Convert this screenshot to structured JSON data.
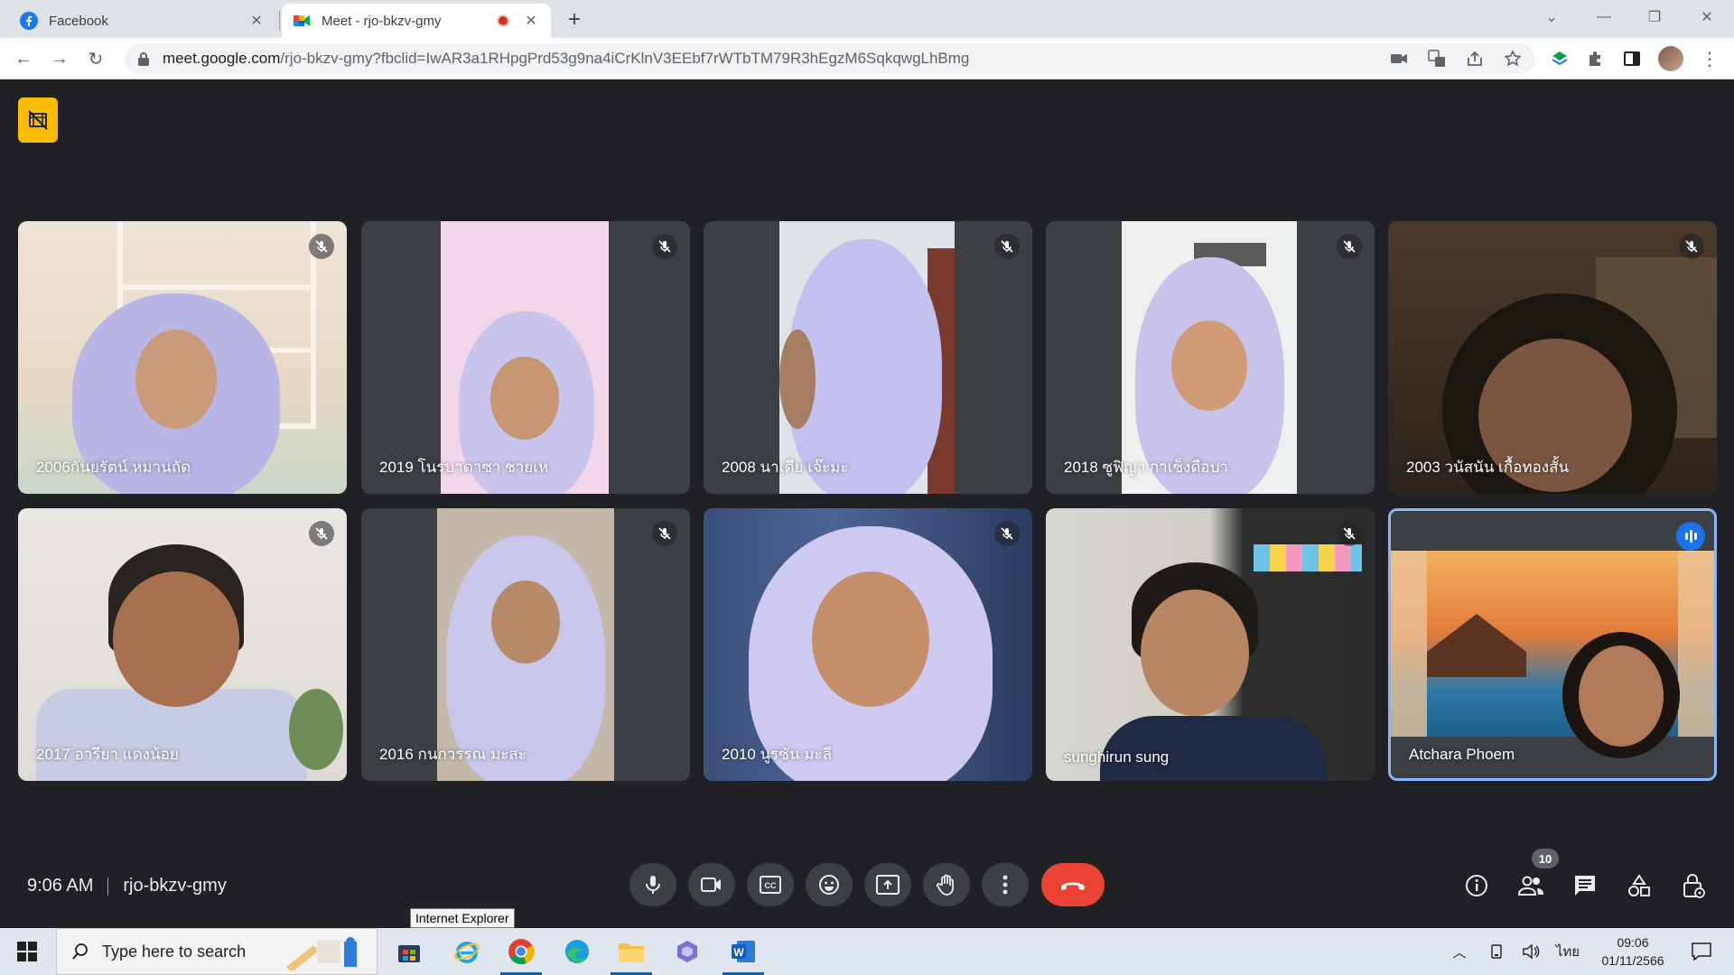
{
  "browser": {
    "tabs": [
      {
        "title": "Facebook",
        "active": false
      },
      {
        "title": "Meet - rjo-bkzv-gmy",
        "active": true,
        "recording": true
      }
    ],
    "url_host": "meet.google.com",
    "url_path": "/rjo-bkzv-gmy?fbclid=IwAR3a1RHpgPrd53g9na4iCrKlnV3EEbf7rWTbTM79R3hEgzM6SqkqwgLhBmg"
  },
  "meet": {
    "participants": [
      {
        "name": "2006กันยรัตน์ หมานถัด",
        "muted": true
      },
      {
        "name": "2019 โนรบาดาซา ชายเห",
        "muted": true
      },
      {
        "name": "2008 นาเดีย เจ๊ะมะ",
        "muted": true
      },
      {
        "name": "2018 ซูฟิญา กาเซ็งดือบา",
        "muted": true
      },
      {
        "name": "2003 วนัสนัน เกื้อทองสั้น",
        "muted": true
      },
      {
        "name": "2017 อารียา แดงน้อย",
        "muted": true
      },
      {
        "name": "2016 กนกวรรณ มะสะ",
        "muted": true
      },
      {
        "name": "2010 นูรซัน มะลี",
        "muted": true
      },
      {
        "name": "sunghirun sung",
        "muted": true
      },
      {
        "name": "Atchara Phoem",
        "muted": false,
        "speaking": true
      }
    ],
    "time": "9:06 AM",
    "meeting_code": "rjo-bkzv-gmy",
    "participant_count": "10",
    "colors": {
      "end_call": "#ea4335",
      "speaking": "#1a73e8",
      "active_border": "#8ab4f8",
      "badge": "#fbbc04"
    }
  },
  "tooltip": "Internet Explorer",
  "taskbar": {
    "search_placeholder": "Type here to search",
    "language": "ไทย",
    "time": "09:06",
    "date": "01/11/2566"
  }
}
